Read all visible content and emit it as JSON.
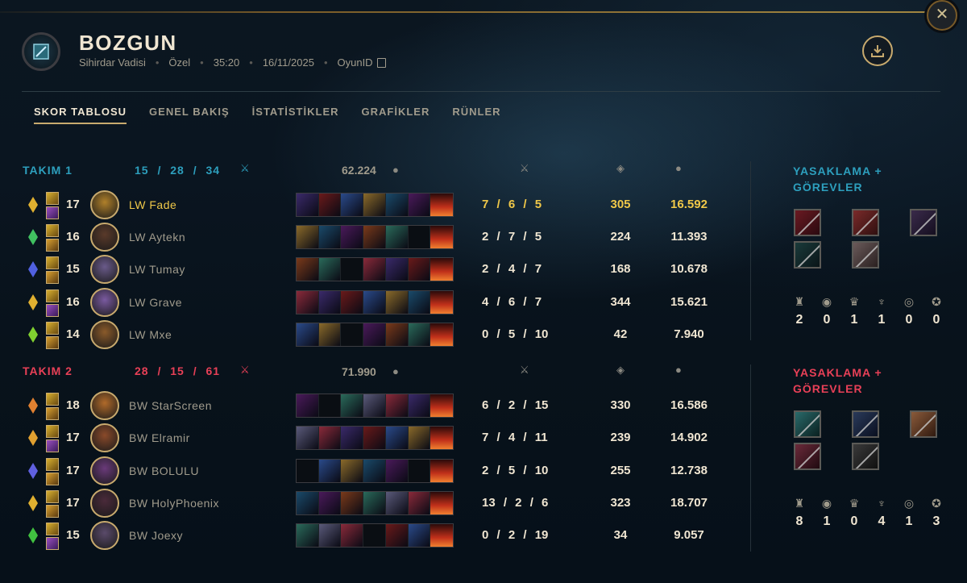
{
  "header": {
    "result": "BOZGUN",
    "map": "Sihirdar Vadisi",
    "queue": "Özel",
    "duration": "35:20",
    "date": "16/11/2025",
    "game_id_label": "OyunID"
  },
  "tabs": [
    "SKOR TABLOSU",
    "GENEL BAKIŞ",
    "İSTATİSTİKLER",
    "GRAFİKLER",
    "RÜNLER"
  ],
  "teams": [
    {
      "name": "TAKIM 1",
      "kda": "15 / 28 / 34",
      "gold": "62.224",
      "bans_title": "YASAKLAMA + GÖREVLER",
      "objectives": [
        "2",
        "0",
        "1",
        "1",
        "0",
        "0"
      ],
      "players": [
        {
          "level": "17",
          "name": "LW Fade",
          "kda": "7 / 6 / 5",
          "cs": "305",
          "gold": "16.592",
          "self": true
        },
        {
          "level": "16",
          "name": "LW Aytekn",
          "kda": "2 / 7 / 5",
          "cs": "224",
          "gold": "11.393"
        },
        {
          "level": "15",
          "name": "LW Tumay",
          "kda": "2 / 4 / 7",
          "cs": "168",
          "gold": "10.678"
        },
        {
          "level": "16",
          "name": "LW Grave",
          "kda": "4 / 6 / 7",
          "cs": "344",
          "gold": "15.621"
        },
        {
          "level": "14",
          "name": "LW Mxe",
          "kda": "0 / 5 / 10",
          "cs": "42",
          "gold": "7.940"
        }
      ]
    },
    {
      "name": "TAKIM 2",
      "kda": "28 / 15 / 61",
      "gold": "71.990",
      "bans_title": "YASAKLAMA + GÖREVLER",
      "objectives": [
        "8",
        "1",
        "0",
        "4",
        "1",
        "3"
      ],
      "players": [
        {
          "level": "18",
          "name": "BW StarScreen",
          "kda": "6 / 2 / 15",
          "cs": "330",
          "gold": "16.586"
        },
        {
          "level": "17",
          "name": "BW Elramir",
          "kda": "7 / 4 / 11",
          "cs": "239",
          "gold": "14.902"
        },
        {
          "level": "17",
          "name": "BW BOLULU",
          "kda": "2 / 5 / 10",
          "cs": "255",
          "gold": "12.738"
        },
        {
          "level": "17",
          "name": "BW HolyPhoenix",
          "kda": "13 / 2 / 6",
          "cs": "323",
          "gold": "18.707"
        },
        {
          "level": "15",
          "name": "BW Joexy",
          "kda": "0 / 2 / 19",
          "cs": "34",
          "gold": "9.057"
        }
      ]
    }
  ],
  "colors": {
    "accent_gold": "#c8aa6e",
    "team1": "#2d9fbd",
    "team2": "#e84057",
    "self_highlight": "#f0c849"
  },
  "icons": [
    "close-icon",
    "download-icon",
    "copy-icon",
    "kills-icon",
    "gold-icon",
    "minion-icon",
    "tower-icon",
    "inhibitor-icon",
    "baron-icon",
    "dragon-icon",
    "herald-icon",
    "void-grub-icon"
  ]
}
